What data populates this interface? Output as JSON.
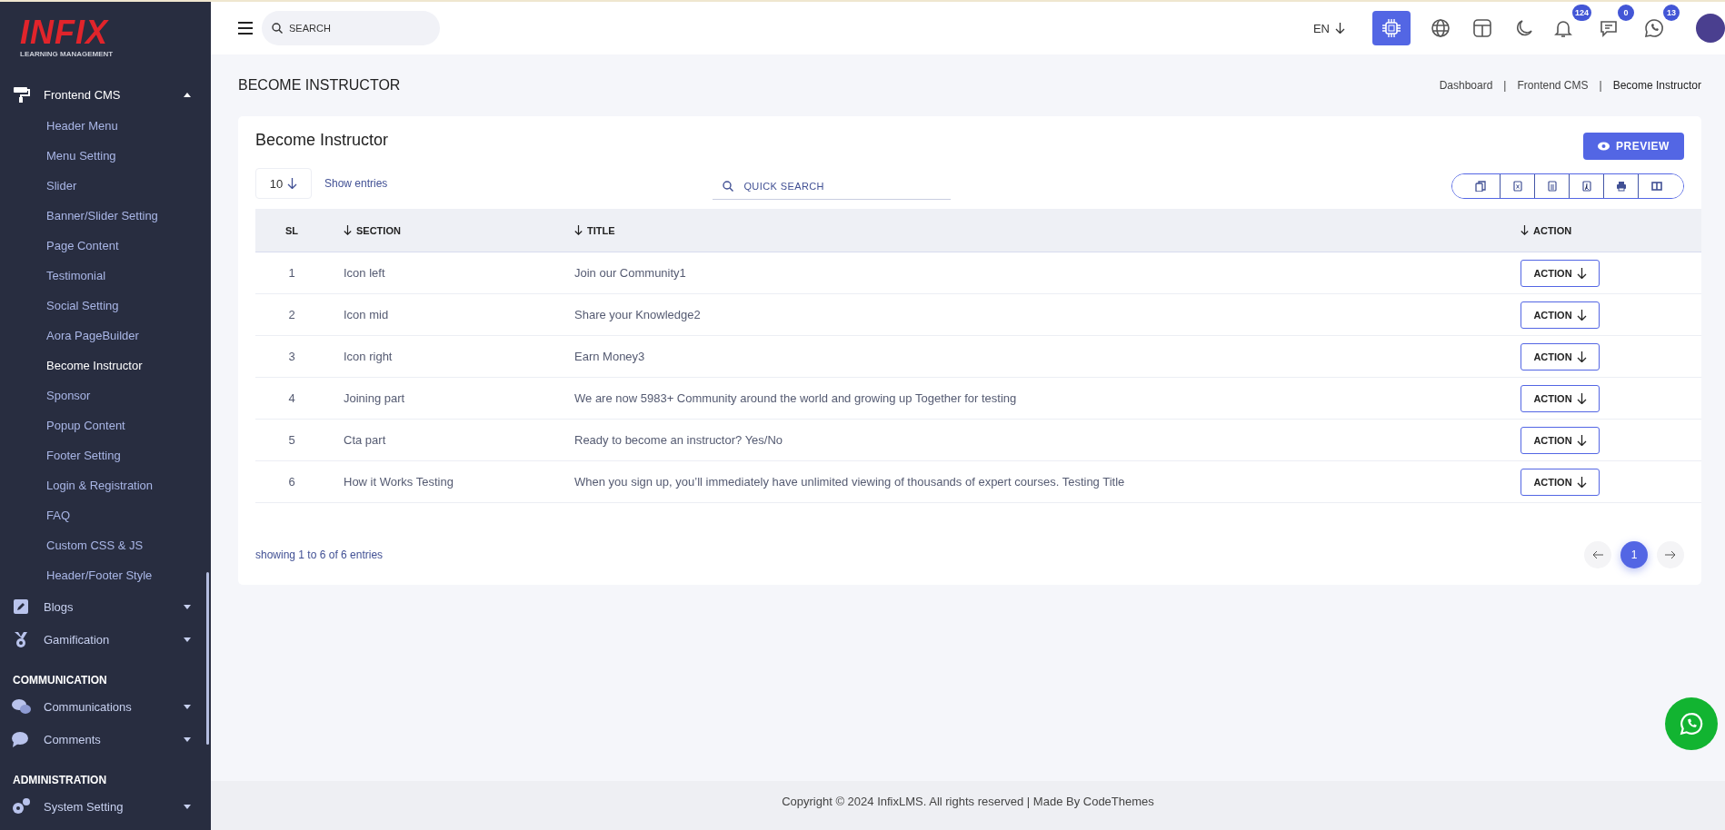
{
  "sidebar": {
    "logo": {
      "wordmark": "INFIX",
      "tagline": "LEARNING MANAGEMENT"
    },
    "groups": [
      {
        "items": [
          {
            "label": "Frontend CMS",
            "kind": "roller",
            "expanded": true,
            "children": [
              {
                "label": "Header Menu",
                "selected": false
              },
              {
                "label": "Menu Setting",
                "selected": false
              },
              {
                "label": "Slider",
                "selected": false
              },
              {
                "label": "Banner/Slider Setting",
                "selected": false
              },
              {
                "label": "Page Content",
                "selected": false
              },
              {
                "label": "Testimonial",
                "selected": false
              },
              {
                "label": "Social Setting",
                "selected": false
              },
              {
                "label": "Aora PageBuilder",
                "selected": false
              },
              {
                "label": "Become Instructor",
                "selected": true
              },
              {
                "label": "Sponsor",
                "selected": false
              },
              {
                "label": "Popup Content",
                "selected": false
              },
              {
                "label": "Footer Setting",
                "selected": false
              },
              {
                "label": "Login & Registration",
                "selected": false
              },
              {
                "label": "FAQ",
                "selected": false
              },
              {
                "label": "Custom CSS & JS",
                "selected": false
              },
              {
                "label": "Header/Footer Style",
                "selected": false
              }
            ]
          },
          {
            "label": "Blogs",
            "kind": "pencil",
            "expanded": false
          },
          {
            "label": "Gamification",
            "kind": "medal",
            "expanded": false
          }
        ]
      },
      {
        "heading": "COMMUNICATION",
        "items": [
          {
            "label": "Communications",
            "kind": "chats",
            "expanded": false
          },
          {
            "label": "Comments",
            "kind": "chat",
            "expanded": false
          }
        ]
      },
      {
        "heading": "ADMINISTRATION",
        "items": [
          {
            "label": "System Setting",
            "kind": "gears",
            "expanded": false
          }
        ]
      }
    ]
  },
  "topbar": {
    "search": {
      "placeholder": "SEARCH"
    },
    "language": "EN",
    "icons": [
      {
        "kind": "ai",
        "selected": true
      },
      {
        "kind": "globe",
        "selected": false
      },
      {
        "kind": "layout",
        "selected": false
      },
      {
        "kind": "moon",
        "selected": false
      },
      {
        "kind": "bell",
        "selected": false,
        "badge": "124"
      },
      {
        "kind": "message",
        "selected": false,
        "badge": "0"
      },
      {
        "kind": "whatsapp",
        "selected": false,
        "badge": "13"
      }
    ]
  },
  "page": {
    "title": "BECOME INSTRUCTOR",
    "breadcrumb": [
      {
        "kind": "link",
        "label": "Dashboard"
      },
      {
        "kind": "separator",
        "label": "|"
      },
      {
        "kind": "link",
        "label": "Frontend CMS"
      },
      {
        "kind": "separator",
        "label": "|"
      },
      {
        "kind": "current",
        "label": "Become Instructor"
      }
    ]
  },
  "card": {
    "title": "Become Instructor",
    "preview_button": "PREVIEW",
    "page_size": "10",
    "show_entries": "Show entries",
    "quick_search": {
      "placeholder": "QUICK SEARCH"
    },
    "export_buttons": [
      {
        "kind": "copy"
      },
      {
        "kind": "excel"
      },
      {
        "kind": "csv"
      },
      {
        "kind": "pdf"
      },
      {
        "kind": "print"
      },
      {
        "kind": "columns"
      }
    ],
    "table": {
      "columns": [
        {
          "label": "SL",
          "sortable": false
        },
        {
          "label": "SECTION",
          "sortable": true
        },
        {
          "label": "TITLE",
          "sortable": true
        },
        {
          "label": "ACTION",
          "sortable": true
        }
      ],
      "rows": [
        {
          "sl": "1",
          "section": "Icon left",
          "title": "Join our Community1",
          "action": "ACTION"
        },
        {
          "sl": "2",
          "section": "Icon mid",
          "title": "Share your Knowledge2",
          "action": "ACTION"
        },
        {
          "sl": "3",
          "section": "Icon right",
          "title": "Earn Money3",
          "action": "ACTION"
        },
        {
          "sl": "4",
          "section": "Joining part",
          "title": "We are now 5983+ Community around the world and growing up Together for testing",
          "action": "ACTION"
        },
        {
          "sl": "5",
          "section": "Cta part",
          "title": "Ready to become an instructor? Yes/No",
          "action": "ACTION"
        },
        {
          "sl": "6",
          "section": "How it Works Testing",
          "title": "When you sign up, you’ll immediately have unlimited viewing of thousands of expert courses. Testing Title",
          "action": "ACTION"
        }
      ]
    },
    "summary": "showing 1 to 6 of 6 entries",
    "pagination": {
      "pages": [
        {
          "label": "1",
          "selected": true
        }
      ]
    }
  },
  "footer": "Copyright © 2024 InfixLMS. All rights reserved | Made By CodeThemes"
}
